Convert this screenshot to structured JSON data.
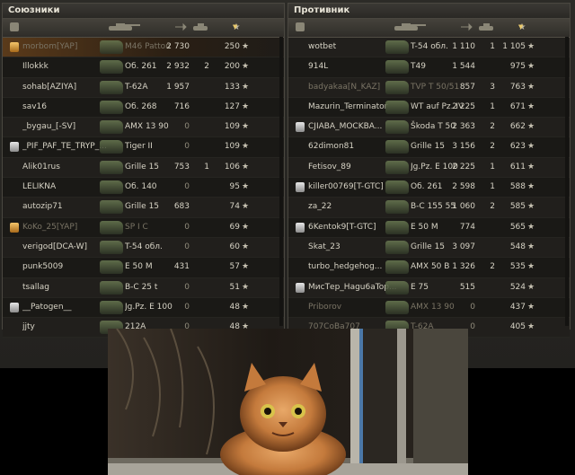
{
  "allies": {
    "title": "Союзники",
    "rows": [
      {
        "platoon": "gold",
        "name": "morbom[YAP]",
        "tank": "M46 Patton",
        "damage": "2 730",
        "frags": "",
        "xp": "250",
        "player": true,
        "dead": true
      },
      {
        "platoon": "",
        "name": "Illokkk",
        "tank": "Об. 261",
        "damage": "2 932",
        "frags": "2",
        "xp": "200",
        "dead": false
      },
      {
        "platoon": "",
        "name": "sohab[AZIYA]",
        "tank": "T-62A",
        "damage": "1 957",
        "frags": "",
        "xp": "133",
        "dead": false
      },
      {
        "platoon": "",
        "name": "sav16",
        "tank": "Об. 268",
        "damage": "716",
        "frags": "",
        "xp": "127",
        "dead": false
      },
      {
        "platoon": "",
        "name": "_bygau_[-SV]",
        "tank": "AMX 13 90",
        "damage": "0",
        "frags": "",
        "xp": "109",
        "dead": false
      },
      {
        "platoon": "silver",
        "name": "_PIF_PAF_TE_TRYP_...",
        "tank": "Tiger II",
        "damage": "0",
        "frags": "",
        "xp": "109",
        "dead": false
      },
      {
        "platoon": "",
        "name": "Alik01rus",
        "tank": "Grille 15",
        "damage": "753",
        "frags": "1",
        "xp": "106",
        "dead": false
      },
      {
        "platoon": "",
        "name": "LELIKNA",
        "tank": "Об. 140",
        "damage": "0",
        "frags": "",
        "xp": "95",
        "dead": false
      },
      {
        "platoon": "",
        "name": "autozip71",
        "tank": "Grille 15",
        "damage": "683",
        "frags": "",
        "xp": "74",
        "dead": false
      },
      {
        "platoon": "gold",
        "name": "KoKo_25[YAP]",
        "tank": "SP I C",
        "damage": "0",
        "frags": "",
        "xp": "69",
        "dead": true
      },
      {
        "platoon": "",
        "name": "verigod[DCA-W]",
        "tank": "T-54 обл.",
        "damage": "0",
        "frags": "",
        "xp": "60",
        "dead": false
      },
      {
        "platoon": "",
        "name": "punk5009",
        "tank": "E 50 M",
        "damage": "431",
        "frags": "",
        "xp": "57",
        "dead": false
      },
      {
        "platoon": "",
        "name": "tsallag",
        "tank": "B-C 25 t",
        "damage": "0",
        "frags": "",
        "xp": "51",
        "dead": false
      },
      {
        "platoon": "silver",
        "name": "__Patogen__",
        "tank": "Jg.Pz. E 100",
        "damage": "0",
        "frags": "",
        "xp": "48",
        "dead": false
      },
      {
        "platoon": "",
        "name": "jjty",
        "tank": "212A",
        "damage": "0",
        "frags": "",
        "xp": "48",
        "dead": false
      }
    ]
  },
  "enemies": {
    "title": "Противник",
    "rows": [
      {
        "platoon": "",
        "name": "wotbet",
        "tank": "T-54 обл.",
        "damage": "1 110",
        "frags": "1",
        "xp": "1 105",
        "dead": false
      },
      {
        "platoon": "",
        "name": "914L",
        "tank": "T49",
        "damage": "1 544",
        "frags": "",
        "xp": "975",
        "dead": false
      },
      {
        "platoon": "",
        "name": "badyakaa[N_KAZ]",
        "tank": "TVP T 50/51",
        "damage": "857",
        "frags": "3",
        "xp": "763",
        "dead": true
      },
      {
        "platoon": "",
        "name": "Mazurin_Terminator",
        "tank": "WT auf Pz. IV",
        "damage": "2 225",
        "frags": "1",
        "xp": "671",
        "dead": false
      },
      {
        "platoon": "silver",
        "name": "CJIABA_MOCKBA...",
        "tank": "Škoda T 50",
        "damage": "2 363",
        "frags": "2",
        "xp": "662",
        "dead": false
      },
      {
        "platoon": "",
        "name": "62dimon81",
        "tank": "Grille 15",
        "damage": "3 156",
        "frags": "2",
        "xp": "623",
        "dead": false
      },
      {
        "platoon": "",
        "name": "Fetisov_89",
        "tank": "Jg.Pz. E 100",
        "damage": "2 225",
        "frags": "1",
        "xp": "611",
        "dead": false
      },
      {
        "platoon": "silver",
        "name": "killer00769[T-GTC]",
        "tank": "Об. 261",
        "damage": "2 598",
        "frags": "1",
        "xp": "588",
        "dead": false
      },
      {
        "platoon": "",
        "name": "za_22",
        "tank": "B-C 155 55",
        "damage": "1 060",
        "frags": "2",
        "xp": "585",
        "dead": false
      },
      {
        "platoon": "silver",
        "name": "6Kentok9[T-GTC]",
        "tank": "E 50 M",
        "damage": "774",
        "frags": "",
        "xp": "565",
        "dead": false
      },
      {
        "platoon": "",
        "name": "Skat_23",
        "tank": "Grille 15",
        "damage": "3 097",
        "frags": "",
        "xp": "548",
        "dead": false
      },
      {
        "platoon": "",
        "name": "turbo_hedgehog...",
        "tank": "AMX 50 B",
        "damage": "1 326",
        "frags": "2",
        "xp": "535",
        "dead": false
      },
      {
        "platoon": "silver",
        "name": "МисТер_Нagu6aTop...",
        "tank": "E 75",
        "damage": "515",
        "frags": "",
        "xp": "524",
        "dead": false
      },
      {
        "platoon": "",
        "name": "Priborov",
        "tank": "AMX 13 90",
        "damage": "0",
        "frags": "",
        "xp": "437",
        "dead": true
      },
      {
        "platoon": "",
        "name": "707CoBa707",
        "tank": "T-62A",
        "damage": "0",
        "frags": "",
        "xp": "405",
        "dead": true
      }
    ]
  },
  "icons": {
    "platoon": "platoon-icon",
    "star": "★",
    "header_icons": [
      "vehicle-icon",
      "damage-icon",
      "frags-icon",
      "xp-star-icon"
    ]
  },
  "colors": {
    "panel_bg": "#1a1916",
    "player_row": "#5a3a1a",
    "text": "#d7d3c5",
    "dead_text": "#7a7465",
    "platoon_gold": "#d9a248",
    "platoon_silver": "#c9c9c9"
  }
}
